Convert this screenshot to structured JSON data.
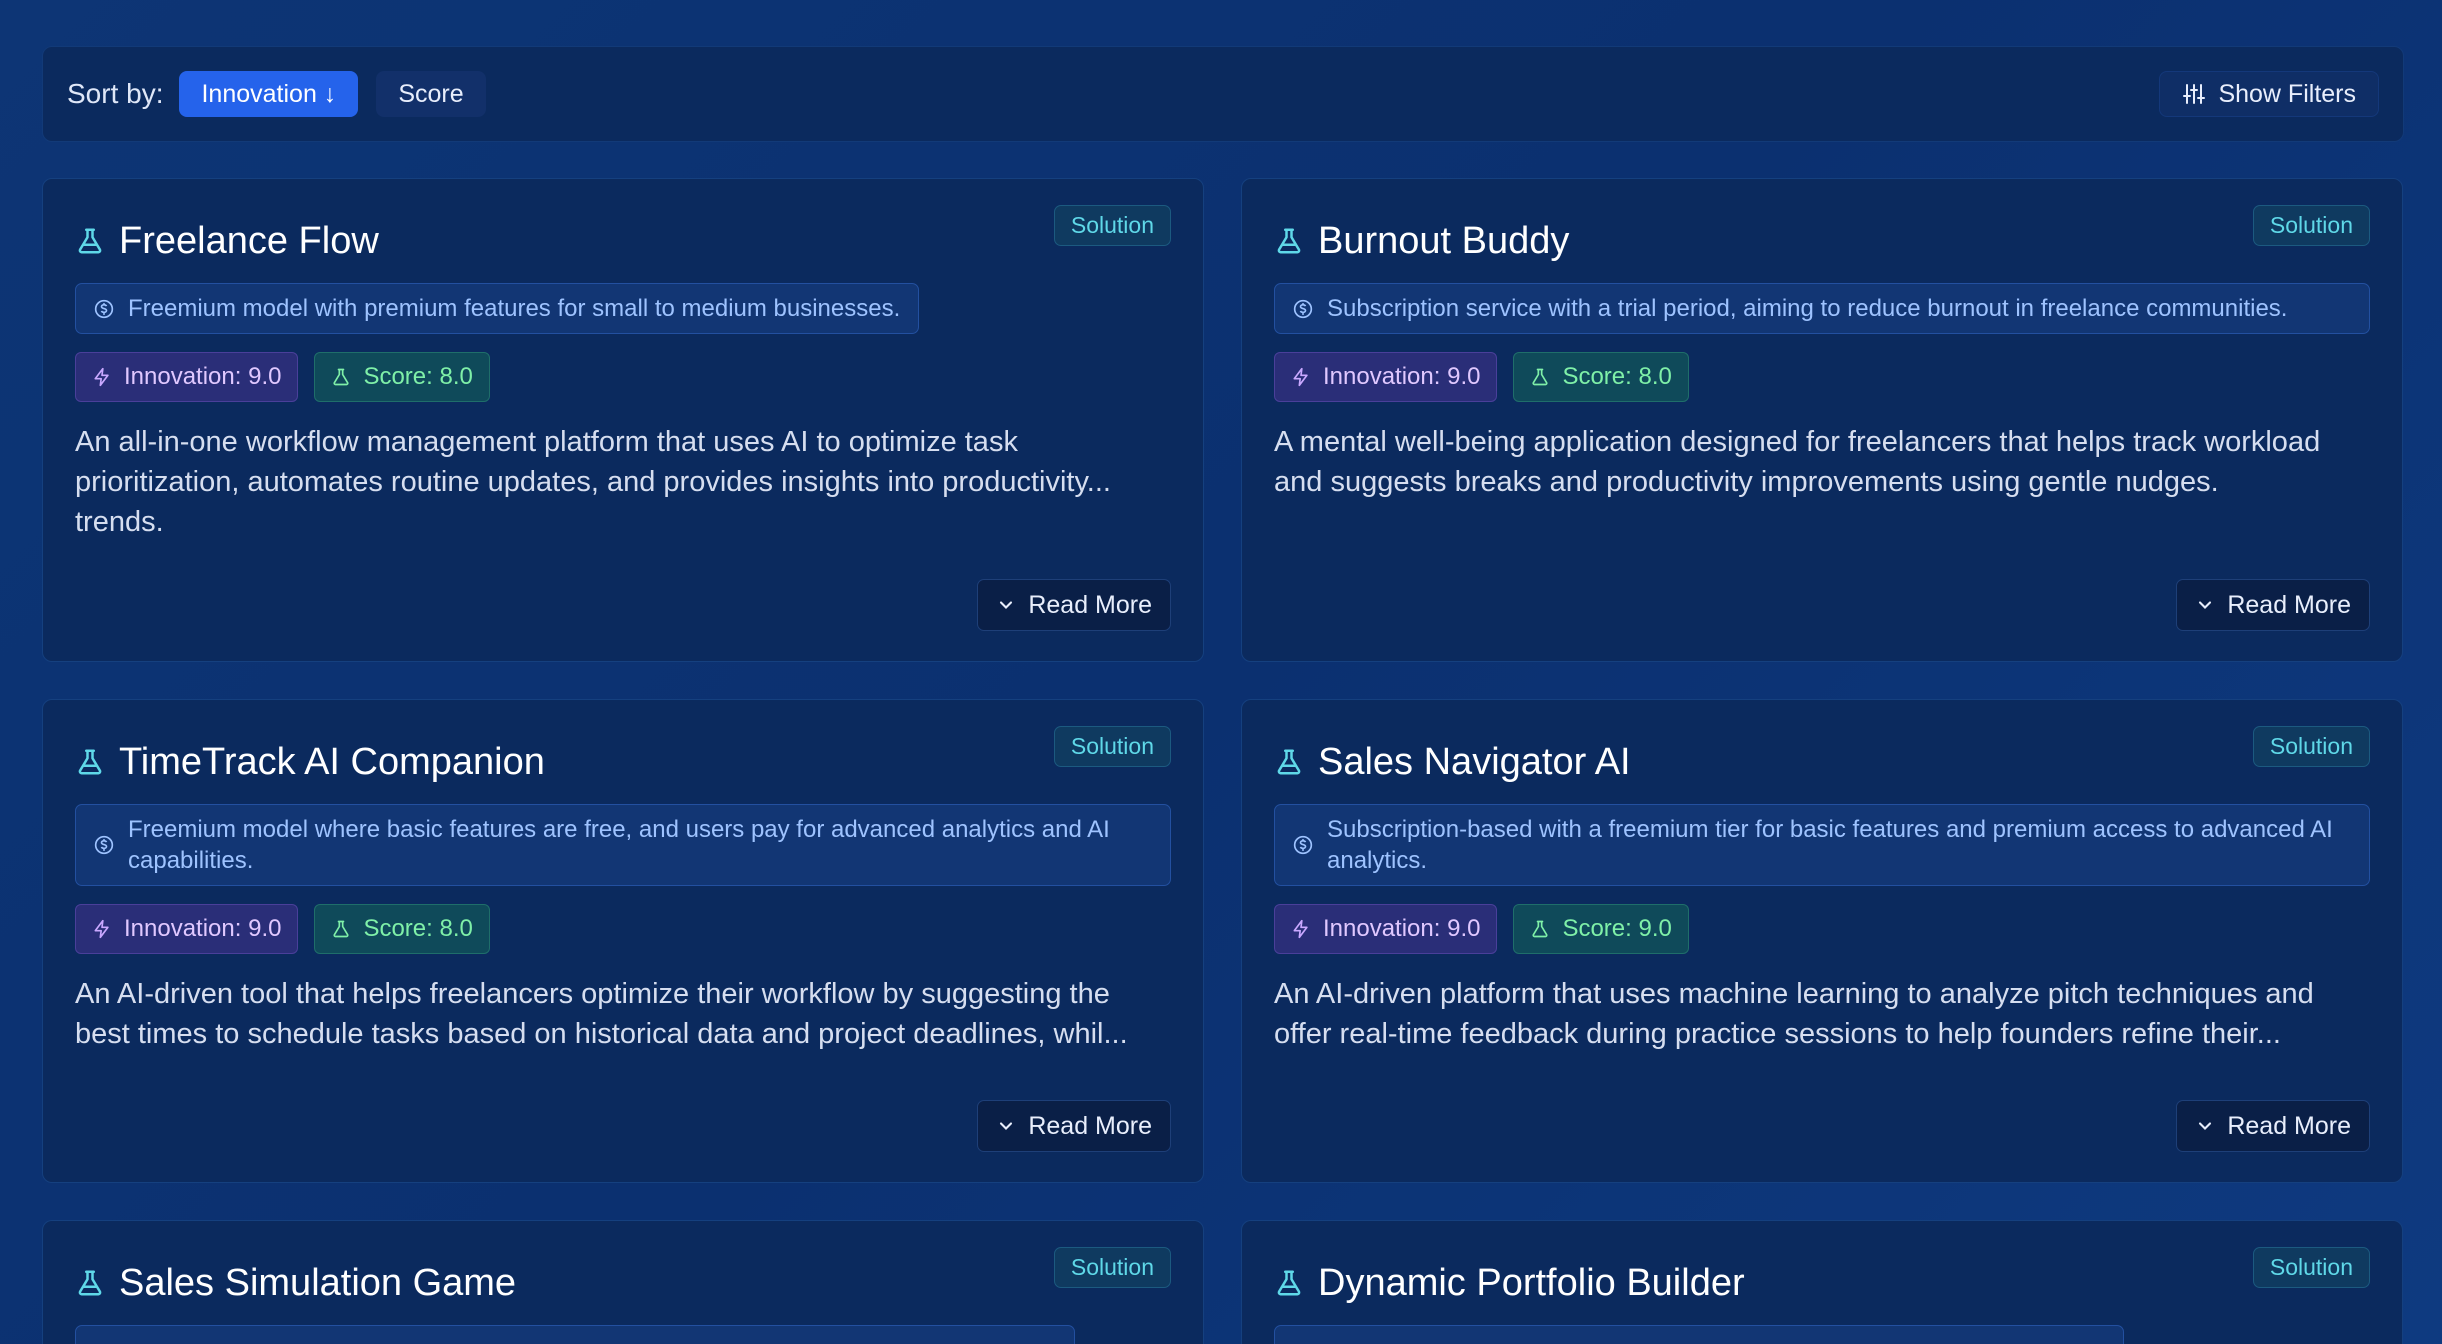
{
  "toolbar": {
    "sort_label": "Sort by:",
    "sort_innovation": "Innovation ↓",
    "sort_score": "Score",
    "show_filters": "Show Filters"
  },
  "cards": [
    {
      "title": "Freelance Flow",
      "badge": "Solution",
      "model": "Freemium model with premium features for small to medium businesses.",
      "innovation": "Innovation: 9.0",
      "score": "Score: 8.0",
      "description": "An all-in-one workflow management platform that uses AI to optimize task prioritization, automates routine updates, and provides insights into productivity... trends.",
      "read_more": "Read More"
    },
    {
      "title": "Burnout Buddy",
      "badge": "Solution",
      "model": "Subscription service with a trial period, aiming to reduce burnout in freelance communities.",
      "innovation": "Innovation: 9.0",
      "score": "Score: 8.0",
      "description": "A mental well-being application designed for freelancers that helps track workload and suggests breaks and productivity improvements using gentle nudges.",
      "read_more": "Read More"
    },
    {
      "title": "TimeTrack AI Companion",
      "badge": "Solution",
      "model": "Freemium model where basic features are free, and users pay for advanced analytics and AI capabilities.",
      "innovation": "Innovation: 9.0",
      "score": "Score: 8.0",
      "description": "An AI-driven tool that helps freelancers optimize their workflow by suggesting the best times to schedule tasks based on historical data and project deadlines, whil...",
      "read_more": "Read More"
    },
    {
      "title": "Sales Navigator AI",
      "badge": "Solution",
      "model": "Subscription-based with a freemium tier for basic features and premium access to advanced AI analytics.",
      "innovation": "Innovation: 9.0",
      "score": "Score: 9.0",
      "description": "An AI-driven platform that uses machine learning to analyze pitch techniques and offer real-time feedback during practice sessions to help founders refine their...",
      "read_more": "Read More"
    },
    {
      "title": "Sales Simulation Game",
      "badge": "Solution"
    },
    {
      "title": "Dynamic Portfolio Builder",
      "badge": "Solution"
    }
  ],
  "colors": {
    "accent": "#2563eb",
    "badge_text": "#5fd8e8",
    "innovation_text": "#e0c8ff",
    "score_text": "#7ff0a8"
  }
}
